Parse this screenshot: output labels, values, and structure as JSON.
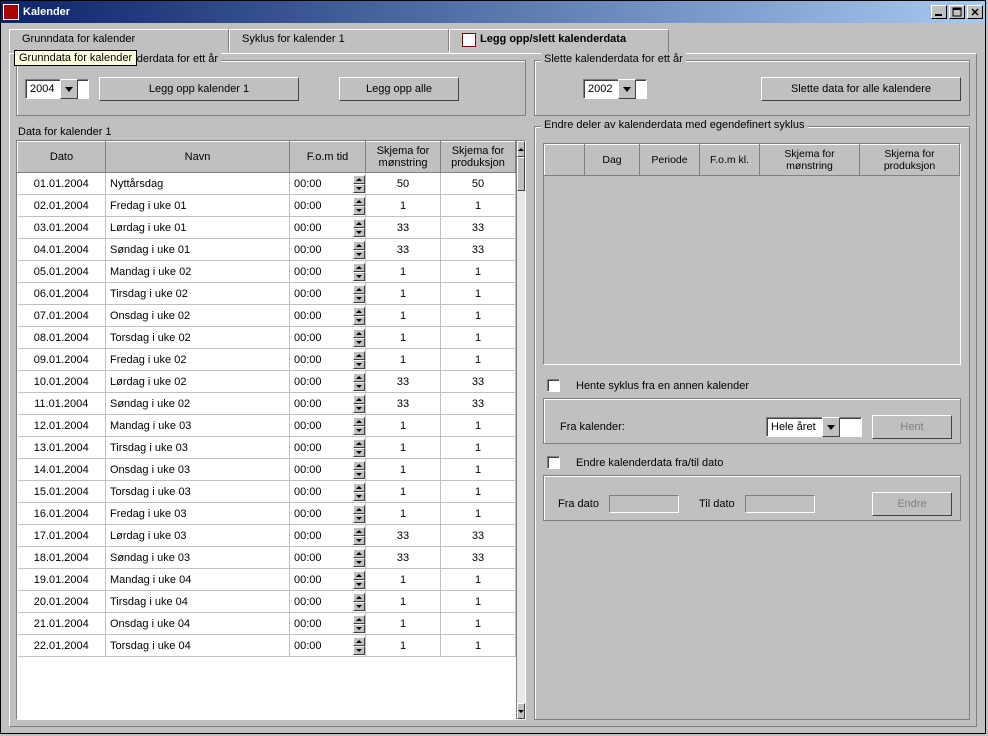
{
  "window": {
    "title": "Kalender"
  },
  "tabs": {
    "t0": "Grunndata for kalender",
    "t1": "Syklus for kalender 1",
    "t2": "Legg opp/slett kalenderdata"
  },
  "tooltip": "Grunndata for kalender",
  "group_add": {
    "legend": "Legg opp en/alle kalenderdata for ett år",
    "year_selected": "2004",
    "btn1": "Legg opp kalender 1",
    "btn2": "Legg opp alle"
  },
  "group_del": {
    "legend": "Slette kalenderdata for ett år",
    "year_selected": "2002",
    "btn": "Slette data for alle kalendere"
  },
  "left_table": {
    "caption": "Data for kalender 1",
    "cols": {
      "c0": "Dato",
      "c1": "Navn",
      "c2": "F.o.m tid",
      "c3": "Skjema for mønstring",
      "c4": "Skjema for produksjon"
    },
    "rows": [
      {
        "dato": "01.01.2004",
        "navn": "Nyttårsdag",
        "tid": "00:00",
        "m": "50",
        "p": "50"
      },
      {
        "dato": "02.01.2004",
        "navn": "Fredag  i uke 01",
        "tid": "00:00",
        "m": "1",
        "p": "1"
      },
      {
        "dato": "03.01.2004",
        "navn": "Lørdag  i uke 01",
        "tid": "00:00",
        "m": "33",
        "p": "33"
      },
      {
        "dato": "04.01.2004",
        "navn": "Søndag  i uke 01",
        "tid": "00:00",
        "m": "33",
        "p": "33"
      },
      {
        "dato": "05.01.2004",
        "navn": "Mandag  i uke 02",
        "tid": "00:00",
        "m": "1",
        "p": "1"
      },
      {
        "dato": "06.01.2004",
        "navn": "Tirsdag  i uke 02",
        "tid": "00:00",
        "m": "1",
        "p": "1"
      },
      {
        "dato": "07.01.2004",
        "navn": "Onsdag  i uke 02",
        "tid": "00:00",
        "m": "1",
        "p": "1"
      },
      {
        "dato": "08.01.2004",
        "navn": "Torsdag  i uke 02",
        "tid": "00:00",
        "m": "1",
        "p": "1"
      },
      {
        "dato": "09.01.2004",
        "navn": "Fredag  i uke 02",
        "tid": "00:00",
        "m": "1",
        "p": "1"
      },
      {
        "dato": "10.01.2004",
        "navn": "Lørdag  i uke 02",
        "tid": "00:00",
        "m": "33",
        "p": "33"
      },
      {
        "dato": "11.01.2004",
        "navn": "Søndag  i uke 02",
        "tid": "00:00",
        "m": "33",
        "p": "33"
      },
      {
        "dato": "12.01.2004",
        "navn": "Mandag  i uke 03",
        "tid": "00:00",
        "m": "1",
        "p": "1"
      },
      {
        "dato": "13.01.2004",
        "navn": "Tirsdag  i uke 03",
        "tid": "00:00",
        "m": "1",
        "p": "1"
      },
      {
        "dato": "14.01.2004",
        "navn": "Onsdag  i uke 03",
        "tid": "00:00",
        "m": "1",
        "p": "1"
      },
      {
        "dato": "15.01.2004",
        "navn": "Torsdag  i uke 03",
        "tid": "00:00",
        "m": "1",
        "p": "1"
      },
      {
        "dato": "16.01.2004",
        "navn": "Fredag  i uke 03",
        "tid": "00:00",
        "m": "1",
        "p": "1"
      },
      {
        "dato": "17.01.2004",
        "navn": "Lørdag  i uke 03",
        "tid": "00:00",
        "m": "33",
        "p": "33"
      },
      {
        "dato": "18.01.2004",
        "navn": "Søndag  i uke 03",
        "tid": "00:00",
        "m": "33",
        "p": "33"
      },
      {
        "dato": "19.01.2004",
        "navn": "Mandag  i uke 04",
        "tid": "00:00",
        "m": "1",
        "p": "1"
      },
      {
        "dato": "20.01.2004",
        "navn": "Tirsdag  i uke 04",
        "tid": "00:00",
        "m": "1",
        "p": "1"
      },
      {
        "dato": "21.01.2004",
        "navn": "Onsdag  i uke 04",
        "tid": "00:00",
        "m": "1",
        "p": "1"
      },
      {
        "dato": "22.01.2004",
        "navn": "Torsdag  i uke 04",
        "tid": "00:00",
        "m": "1",
        "p": "1"
      }
    ]
  },
  "group_edit": {
    "legend": "Endre deler av kalenderdata med egendefinert syklus",
    "cols": {
      "c0": "",
      "c1": "Dag",
      "c2": "Periode",
      "c3": "F.o.m kl.",
      "c4": "Skjema for mønstring",
      "c5": "Skjema for produksjon"
    },
    "chk_fetch_label": "Hente syklus fra en annen kalender",
    "from_cal_label": "Fra kalender:",
    "from_cal_selected": "Hele året",
    "btn_fetch": "Hent",
    "chk_edit_label": "Endre kalenderdata fra/til dato",
    "from_date_label": "Fra dato",
    "to_date_label": "Til dato",
    "btn_edit": "Endre"
  }
}
